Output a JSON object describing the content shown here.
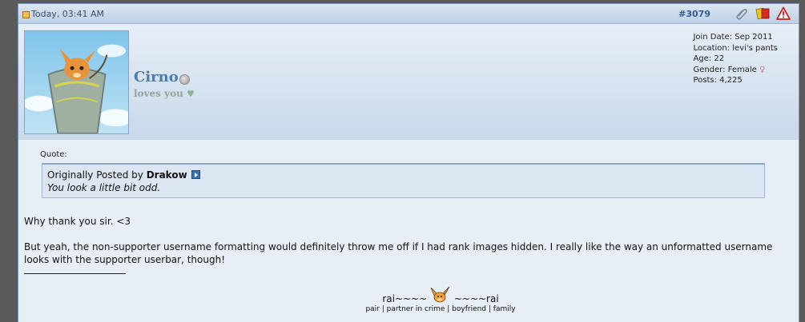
{
  "post": {
    "date": "Today, 03:41 AM",
    "number": "#3079"
  },
  "user": {
    "name": "Cirno",
    "title": "loves you",
    "title_heart": "♥",
    "stats": {
      "join_date": "Join Date: Sep 2011",
      "location": "Location: levi's pants",
      "age": "Age: 22",
      "gender": "Gender: Female",
      "gender_symbol": "♀",
      "posts": "Posts: 4,225"
    }
  },
  "quote": {
    "label": "Quote:",
    "prefix": "Originally Posted by",
    "author": "Drakow",
    "text": "You look a little bit odd."
  },
  "message": {
    "line1": "Why thank you sir. <3",
    "line2": "But yeah, the non-supporter username formatting would definitely throw me off if I had rank images hidden. I really like the way an unformatted username looks with the supporter userbar, though!"
  },
  "signature": {
    "left": "rai~~~~",
    "right": "~~~~rai",
    "sub": "pair | partner in crime | boyfriend | family"
  },
  "colors": {
    "header_bg": "#bcd0e5",
    "username": "#4c7bb0",
    "post_number": "#2e5a93"
  }
}
